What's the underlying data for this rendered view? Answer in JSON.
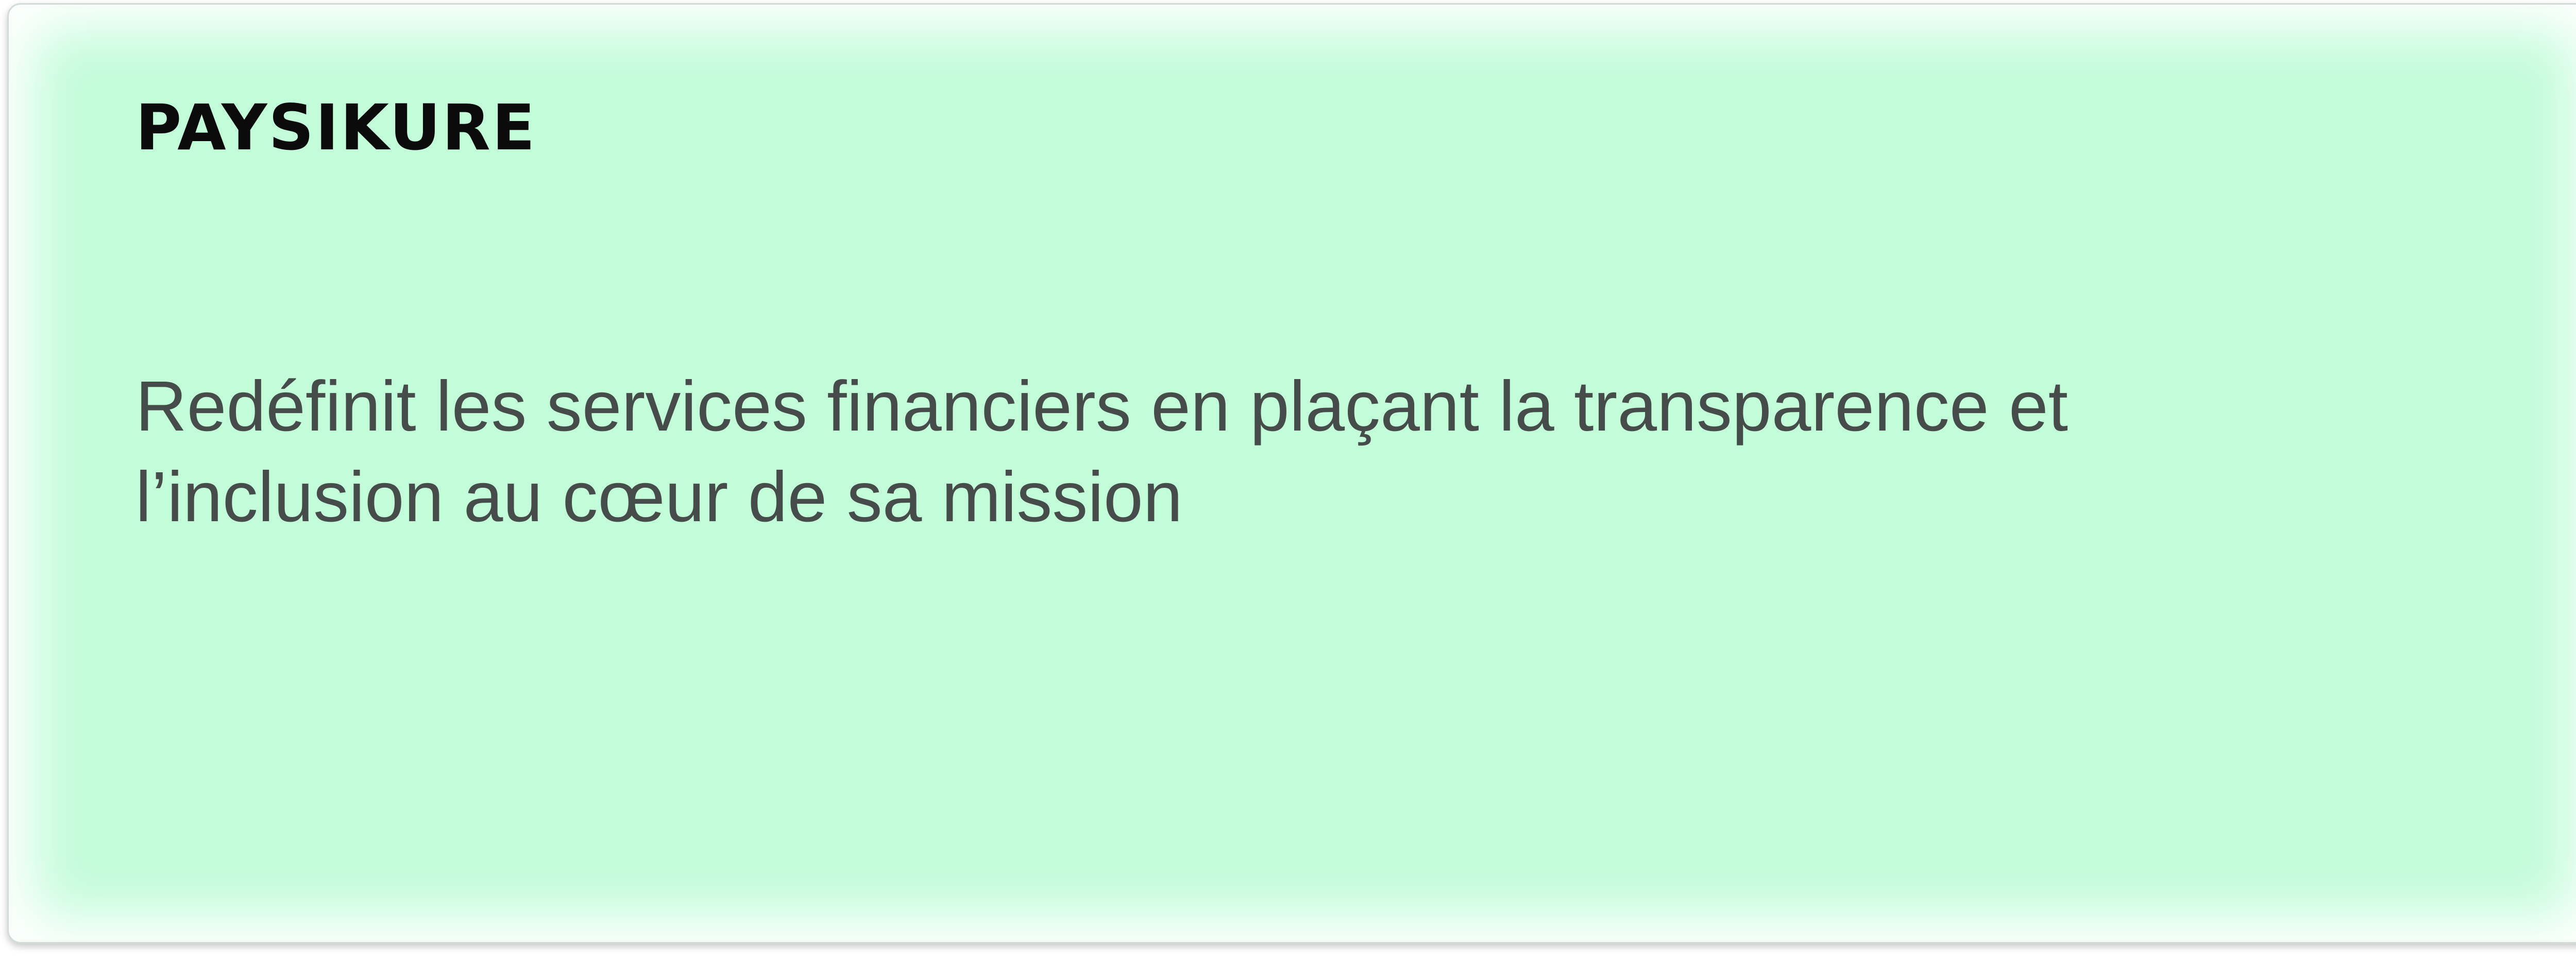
{
  "card": {
    "brand": "PAYSIKURE",
    "tagline_line1": "Redéfinit les services financiers en plaçant la transparence et",
    "tagline_line2": "l’inclusion au cœur de sa mission",
    "colors": {
      "background": "#c2fcd9",
      "brand_text": "#0b0b0b",
      "body_text": "#464c49"
    }
  }
}
